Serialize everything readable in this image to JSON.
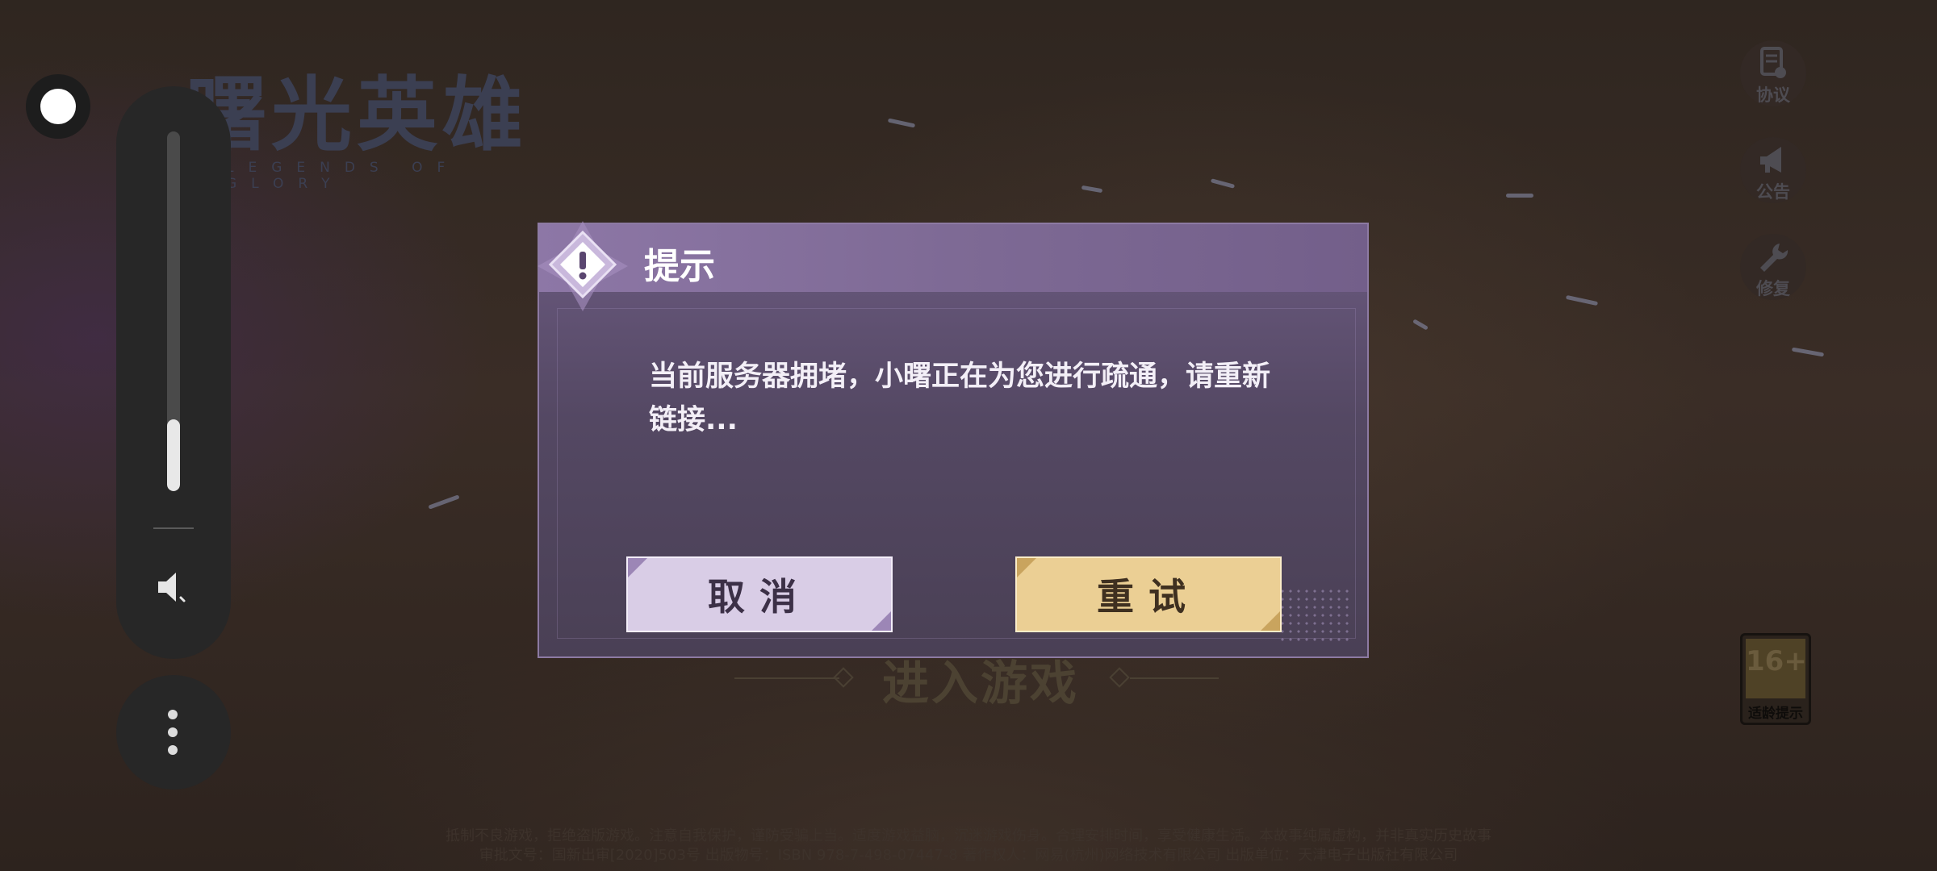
{
  "logo": {
    "title_cn": "曙光英雄",
    "title_en": "LEGENDS OF GLORY"
  },
  "volume": {
    "level_fraction": 0.2
  },
  "side_buttons": [
    {
      "label": "协议",
      "icon": "agreement-icon"
    },
    {
      "label": "公告",
      "icon": "megaphone-icon"
    },
    {
      "label": "修复",
      "icon": "wrench-icon"
    }
  ],
  "age_rating": {
    "number": "16+",
    "label": "适龄提示"
  },
  "enter_game": "进入游戏",
  "legal": {
    "line1": "抵制不良游戏，拒绝盗版游戏。注意自我保护，谨防受骗上当。适度游戏益脑，沉迷游戏伤身。合理安排时间，享受健康生活。本故事纯属虚构，并非真实历史故事",
    "line2": "审批文号：国新出审[2020]503号 出版物号：ISBN 978-7-498-07447-8 著作权人：网易(杭州)网络技术有限公司 出版单位：天津电子出版社有限公司"
  },
  "dialog": {
    "title": "提示",
    "message": "当前服务器拥堵，小曙正在为您进行疏通，请重新链接...",
    "cancel_label": "取消",
    "retry_label": "重试"
  },
  "colors": {
    "dialog_header": "#8d77a6",
    "dialog_body": "#544863",
    "cancel_button": "#d9cde6",
    "retry_button": "#ebcf94"
  }
}
